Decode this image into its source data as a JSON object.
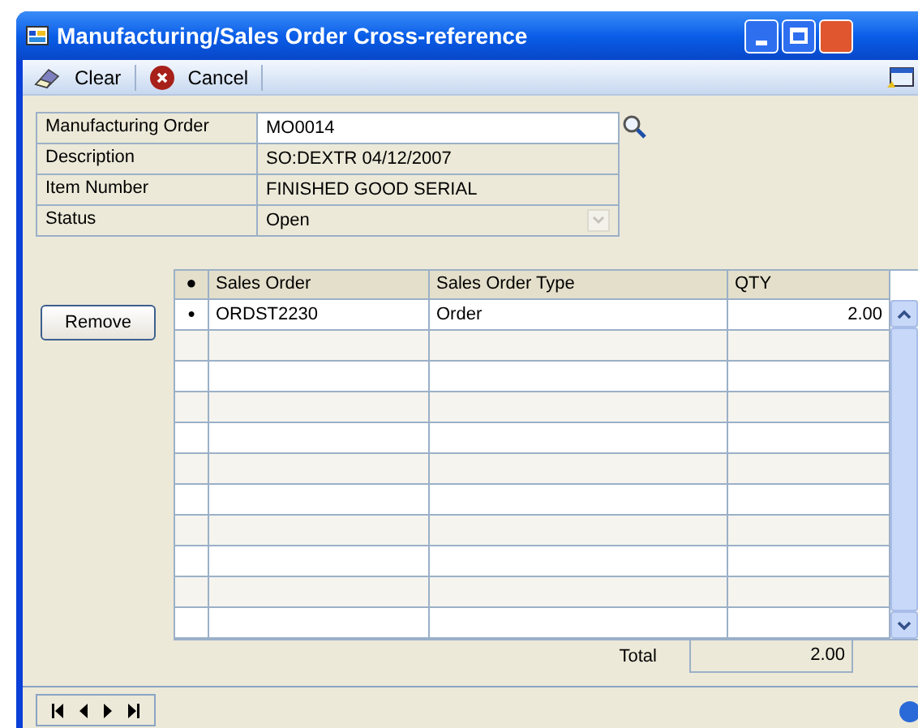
{
  "window": {
    "title": "Manufacturing/Sales Order Cross-reference"
  },
  "toolbar": [
    "Clear",
    "Cancel"
  ],
  "fields": [
    {
      "label": "Manufacturing Order",
      "value": "MO0014",
      "kind": "lookup"
    },
    {
      "label": "Description",
      "value": "SO:DEXTR 04/12/2007",
      "kind": "readonly"
    },
    {
      "label": "Item Number",
      "value": "FINISHED GOOD SERIAL",
      "kind": "readonly"
    },
    {
      "label": "Status",
      "value": "Open",
      "kind": "dropdown"
    }
  ],
  "remove_button": "Remove",
  "table": {
    "columns": [
      "●",
      "Sales Order",
      "Sales Order Type",
      "QTY"
    ],
    "rows": [
      {
        "marker": "●",
        "sales_order": "ORDST2230",
        "type": "Order",
        "qty": "2.00"
      }
    ]
  },
  "total": {
    "label": "Total",
    "value": "2.00"
  }
}
